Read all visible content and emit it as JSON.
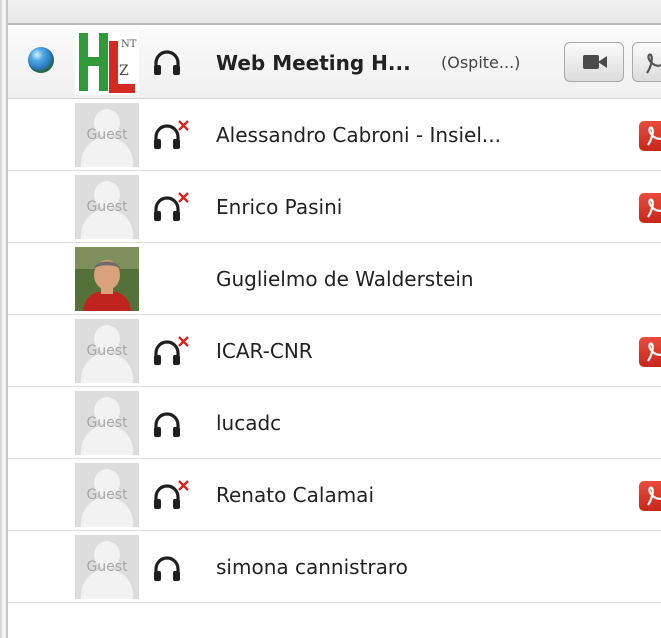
{
  "host": {
    "name": "Web Meeting H...",
    "role": "(Ospite...)",
    "status_icon": "presence-globe-icon",
    "avatar_icon": "hl-logo-icon"
  },
  "participants": [
    {
      "name": "Alessandro Cabroni - Insiel...",
      "avatar": "Guest",
      "headset": "headset-muted",
      "pdf": true
    },
    {
      "name": "Enrico Pasini",
      "avatar": "Guest",
      "headset": "headset-muted",
      "pdf": true
    },
    {
      "name": "Guglielmo de Walderstein",
      "avatar": "photo",
      "headset": "none",
      "pdf": false
    },
    {
      "name": "ICAR-CNR",
      "avatar": "Guest",
      "headset": "headset-muted",
      "pdf": true
    },
    {
      "name": "lucadc",
      "avatar": "Guest",
      "headset": "headset",
      "pdf": false
    },
    {
      "name": "Renato Calamai",
      "avatar": "Guest",
      "headset": "headset-muted",
      "pdf": true
    },
    {
      "name": "simona cannistraro",
      "avatar": "Guest",
      "headset": "headset",
      "pdf": false
    }
  ],
  "colors": {
    "muted_x": "#d9241c",
    "pdf_red": "#d9362a",
    "guest_avatar_bg": "#dcdcdc"
  }
}
